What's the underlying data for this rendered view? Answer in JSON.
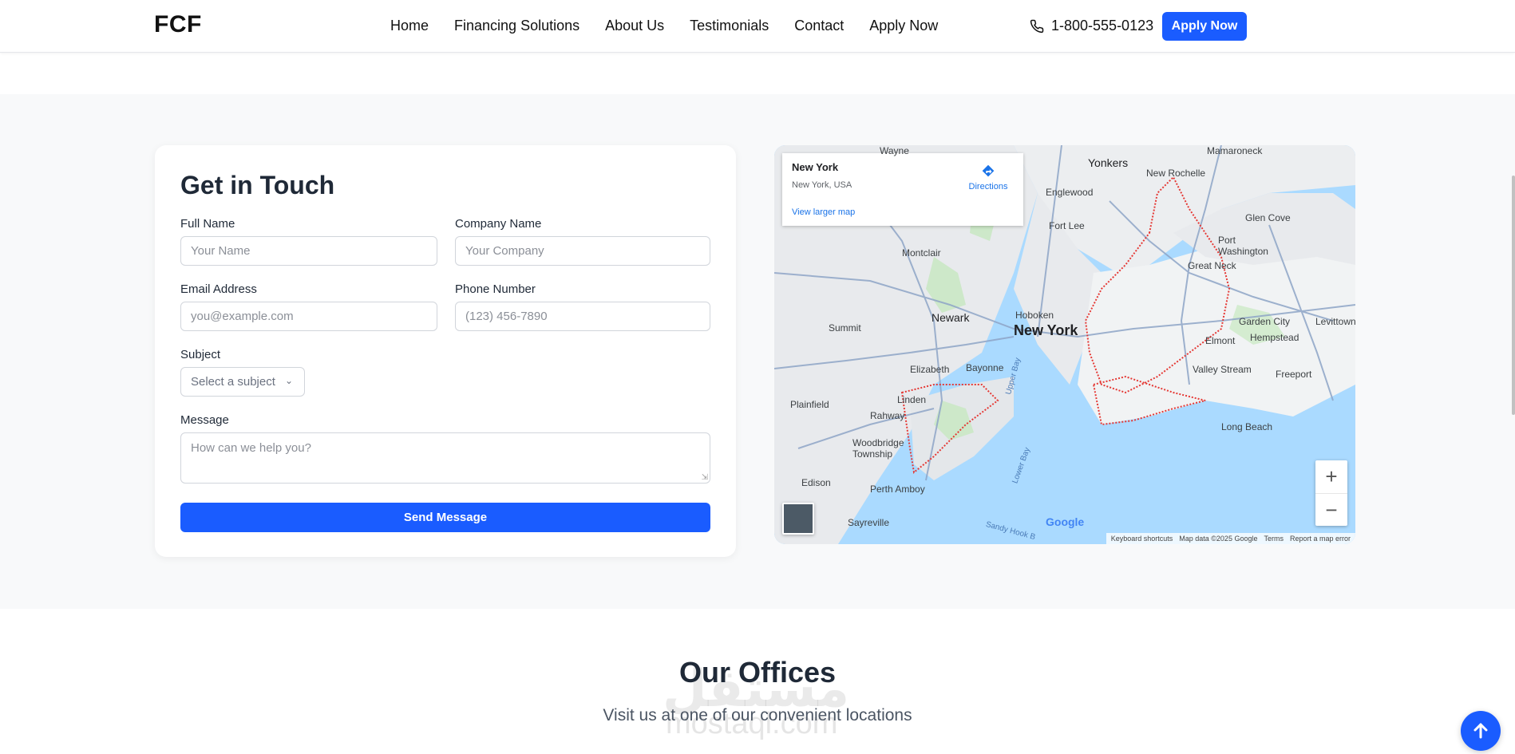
{
  "header": {
    "logo": "FCF",
    "nav": [
      "Home",
      "Financing Solutions",
      "About Us",
      "Testimonials",
      "Contact",
      "Apply Now"
    ],
    "phone": "1-800-555-0123",
    "apply_button": "Apply Now"
  },
  "contact": {
    "title": "Get in Touch",
    "full_name": {
      "label": "Full Name",
      "placeholder": "Your Name"
    },
    "company": {
      "label": "Company Name",
      "placeholder": "Your Company"
    },
    "email": {
      "label": "Email Address",
      "placeholder": "you@example.com"
    },
    "phone": {
      "label": "Phone Number",
      "placeholder": "(123) 456-7890"
    },
    "subject": {
      "label": "Subject",
      "value": "Select a subject"
    },
    "message": {
      "label": "Message",
      "placeholder": "How can we help you?"
    },
    "send_button": "Send Message"
  },
  "map": {
    "place_title": "New York",
    "place_subtitle": "New York, USA",
    "directions": "Directions",
    "larger_map": "View larger map",
    "labels": {
      "center": "New York",
      "yonkers": "Yonkers",
      "newark": "Newark",
      "hoboken": "Hoboken",
      "montclair": "Montclair",
      "elizabeth": "Elizabeth",
      "bayonne": "Bayonne",
      "linden": "Linden",
      "rahway": "Rahway",
      "edison": "Edison",
      "perth_amboy": "Perth Amboy",
      "summit": "Summit",
      "plainfield": "Plainfield",
      "woodbridge": "Woodbridge Township",
      "sayreville": "Sayreville",
      "new_rochelle": "New Rochelle",
      "mamaroneck": "Mamaroneck",
      "glen_cove": "Glen Cove",
      "port_washington": "Port Washington",
      "great_neck": "Great Neck",
      "garden_city": "Garden City",
      "hempstead": "Hempstead",
      "levittown": "Levittown",
      "elmont": "Elmont",
      "valley_stream": "Valley Stream",
      "freeport": "Freeport",
      "long_beach": "Long Beach",
      "englewood": "Englewood",
      "fort_lee": "Fort Lee",
      "wayne": "Wayne",
      "upper_bay": "Upper Bay",
      "lower_bay": "Lower Bay",
      "sandy_hook": "Sandy Hook B"
    },
    "google": "Google",
    "attribution": [
      "Keyboard shortcuts",
      "Map data ©2025 Google",
      "Terms",
      "Report a map error"
    ]
  },
  "offices": {
    "title": "Our Offices",
    "subtitle": "Visit us at one of our convenient locations"
  },
  "watermark": {
    "arabic": "مستقل",
    "latin": "mostaql.com"
  },
  "colors": {
    "primary": "#1a5cff",
    "band_bg": "#f8f9fa",
    "water": "#aadaff"
  }
}
